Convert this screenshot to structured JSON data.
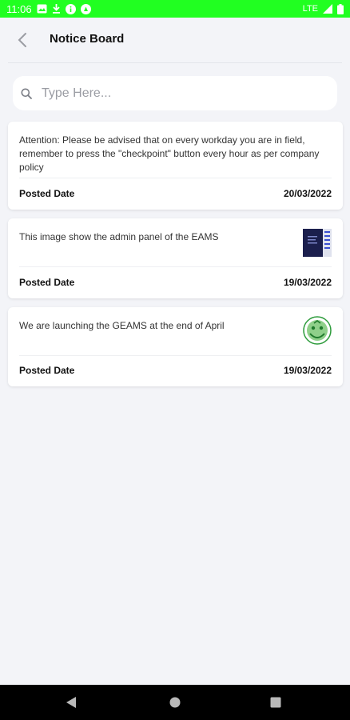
{
  "status_bar": {
    "time": "11:06",
    "network": "LTE",
    "left_icons": [
      "image-icon",
      "download-icon",
      "info-icon",
      "vpn-icon"
    ],
    "right_icons": [
      "signal-icon",
      "battery-icon"
    ],
    "background": "#21ff21"
  },
  "header": {
    "title": "Notice Board",
    "back_icon": "chevron-left-icon"
  },
  "search": {
    "placeholder": "Type Here...",
    "value": "",
    "icon": "search-icon"
  },
  "notices": [
    {
      "text": "Attention: Please be advised that on every workday you are in field, remember to press the \"checkpoint\" button every hour as per company policy",
      "posted_label": "Posted Date",
      "date": "20/03/2022",
      "has_thumbnail": false
    },
    {
      "text": "This image show the admin panel of the EAMS",
      "posted_label": "Posted Date",
      "date": "19/03/2022",
      "has_thumbnail": true,
      "thumbnail": "admin-panel-screenshot-thumbnail"
    },
    {
      "text": "We are launching the GEAMS at the end of April",
      "posted_label": "Posted Date",
      "date": "19/03/2022",
      "has_thumbnail": true,
      "thumbnail": "geams-logo-thumbnail"
    }
  ],
  "nav_bar": {
    "buttons": [
      "back-triangle-icon",
      "home-circle-icon",
      "recents-square-icon"
    ]
  }
}
